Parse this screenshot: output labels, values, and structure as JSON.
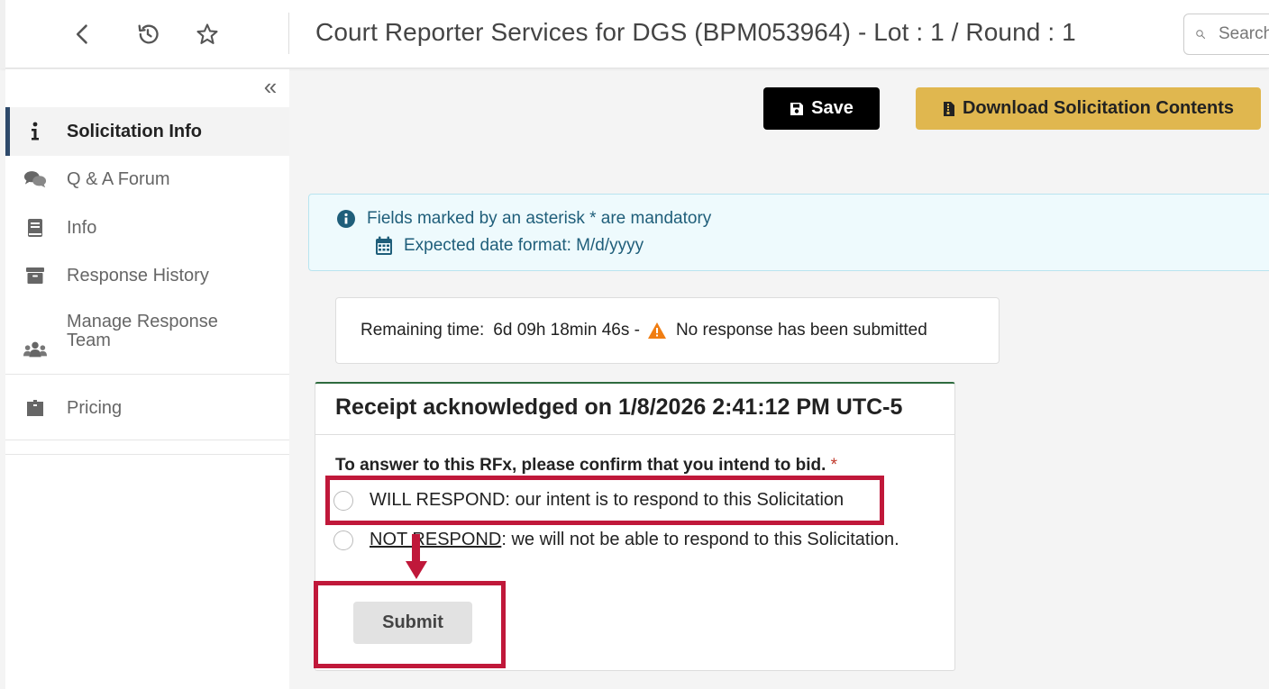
{
  "header": {
    "title": "Court Reporter Services for DGS (BPM053964) - Lot : 1 / Round : 1",
    "search_placeholder": "Search"
  },
  "sidebar": {
    "collapse_glyph": "«",
    "items": [
      {
        "label": "Solicitation Info",
        "icon": "info-icon",
        "active": true
      },
      {
        "label": "Q & A Forum",
        "icon": "comments-icon"
      },
      {
        "label": "Info",
        "icon": "book-icon"
      },
      {
        "label": "Response History",
        "icon": "archive-icon"
      },
      {
        "label": "Manage Response Team",
        "icon": "users-icon"
      },
      {
        "label": "Pricing",
        "icon": "box-icon"
      }
    ]
  },
  "toolbar": {
    "save_label": "Save",
    "download_label": "Download Solicitation Contents"
  },
  "alert": {
    "mandatory_text": "Fields marked by an asterisk * are mandatory",
    "date_format_text": "Expected date format: M/d/yyyy"
  },
  "status": {
    "remaining_label": "Remaining time:",
    "remaining_value": "6d 09h 18min 46s -",
    "warning_text": "No response has been submitted"
  },
  "receipt": {
    "title": "Receipt acknowledged on 1/8/2026 2:41:12 PM UTC-5",
    "question": "To answer to this RFx, please confirm that you intend to bid.",
    "required_mark": "*",
    "option_respond": "WILL RESPOND: our intent is to respond to this Solicitation",
    "option_not_respond_key": "NOT RESPOND",
    "option_not_respond_rest": ": we will not be able to respond to this Solicitation.",
    "submit_label": "Submit"
  },
  "colors": {
    "annotation": "#c0183a",
    "download_button": "#e0b74f",
    "save_button": "#000000",
    "alert_bg": "#eefafd",
    "active_marker": "#2e4a6b"
  }
}
